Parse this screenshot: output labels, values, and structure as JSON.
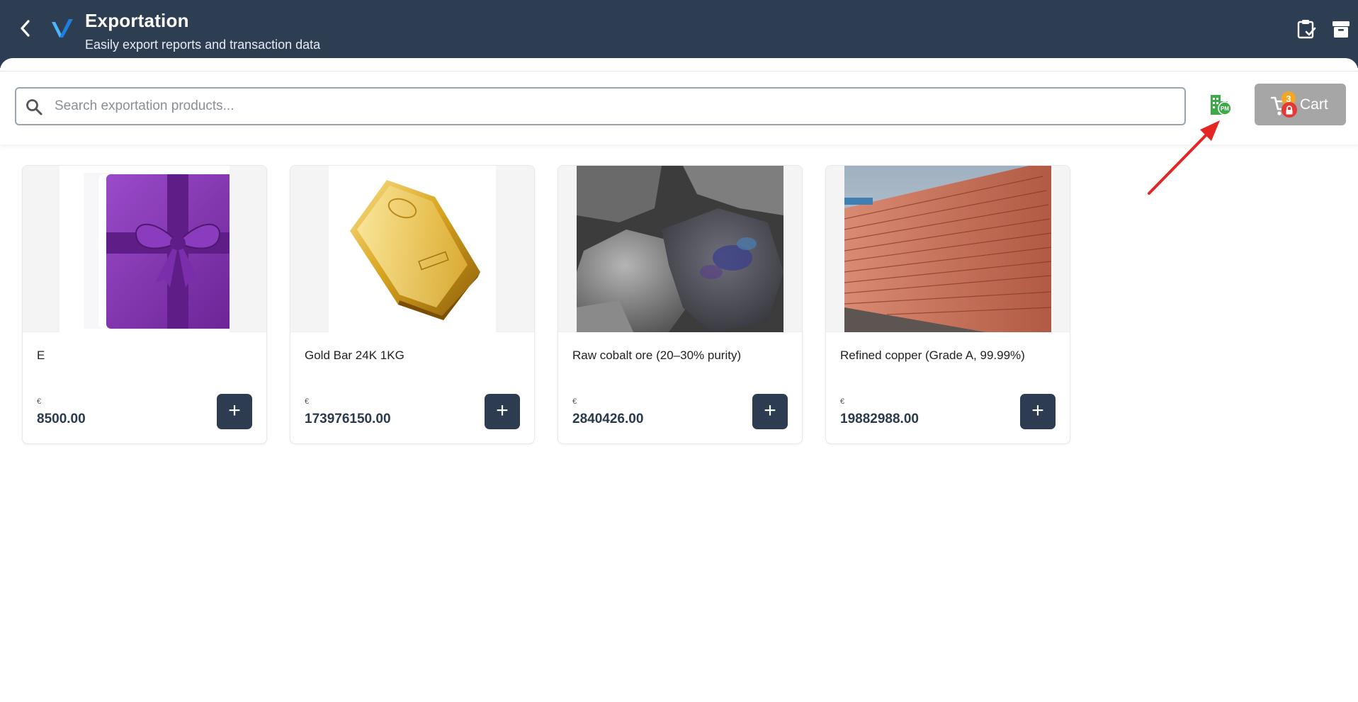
{
  "header": {
    "title": "Exportation",
    "subtitle": "Easily export reports and transaction data",
    "icons": [
      "back-chevron-icon",
      "brand-logo",
      "clipboard-check-icon",
      "archive-box-icon"
    ]
  },
  "search": {
    "placeholder": "Search exportation products..."
  },
  "toolbar": {
    "pm_icon": "building-pm-icon",
    "pm_badge": "PM",
    "cart_label": "Cart",
    "cart_count": "3",
    "cart_locked": true
  },
  "products": [
    {
      "name": "E",
      "currency": "€",
      "price": "8500.00",
      "image": "purple-gift-box"
    },
    {
      "name": "Gold Bar 24K 1KG",
      "currency": "€",
      "price": "173976150.00",
      "image": "gold-bar"
    },
    {
      "name": "Raw cobalt ore (20–30% purity)",
      "currency": "€",
      "price": "2840426.00",
      "image": "cobalt-ore"
    },
    {
      "name": "Refined copper (Grade A, 99.99%)",
      "currency": "€",
      "price": "19882988.00",
      "image": "copper-sheets"
    }
  ],
  "add_label": "+",
  "colors": {
    "header_bg": "#2e3e52",
    "accent_blue": "#1e88e5",
    "button_dark": "#2d3c50",
    "cart_disabled": "#a6a6a6",
    "badge_orange": "#f5a623",
    "badge_red": "#e53935",
    "pm_green": "#3daa4a",
    "annotation_red": "#e52521"
  }
}
